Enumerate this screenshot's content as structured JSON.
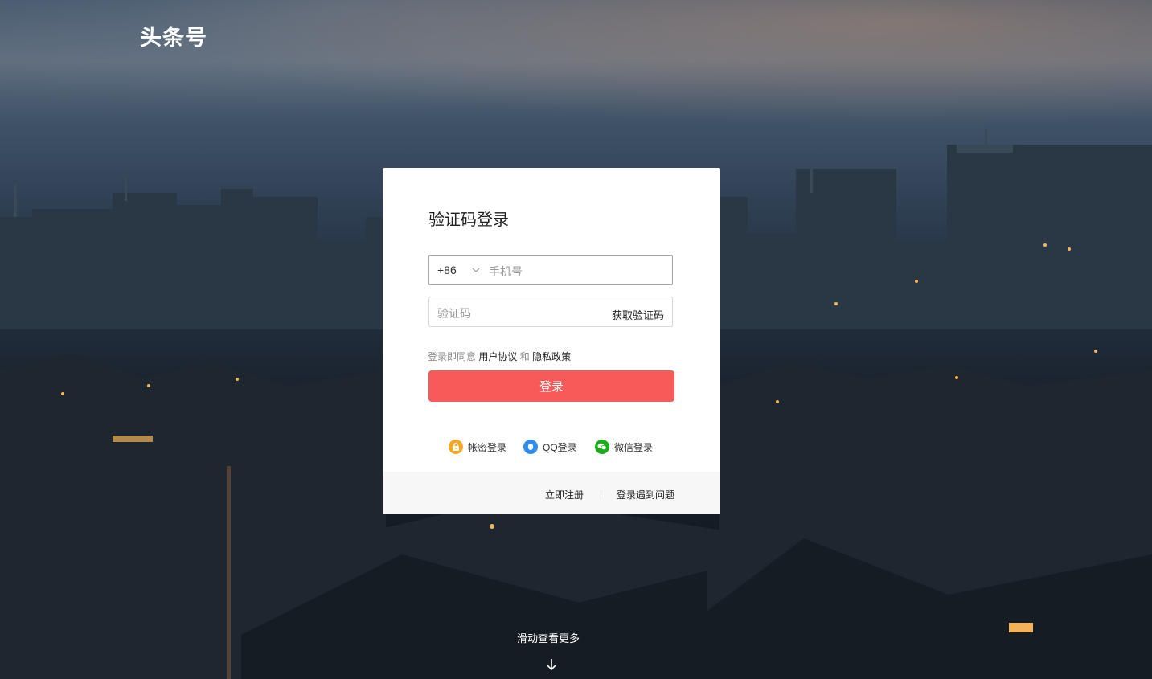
{
  "header": {
    "logo_text": "头条号"
  },
  "login": {
    "title": "验证码登录",
    "country_code": "+86",
    "phone_placeholder": "手机号",
    "code_placeholder": "验证码",
    "get_code_label": "获取验证码",
    "agree_prefix": "登录即同意",
    "user_agreement": "用户协议",
    "agree_and": "和",
    "privacy_policy": "隐私政策",
    "submit_label": "登录",
    "alt_methods": [
      {
        "label": "帐密登录",
        "icon": "lock-icon",
        "color": "#f5a623"
      },
      {
        "label": "QQ登录",
        "icon": "qq-icon",
        "color": "#2d8cf0"
      },
      {
        "label": "微信登录",
        "icon": "wechat-icon",
        "color": "#1aad19"
      }
    ],
    "footer": {
      "register": "立即注册",
      "problem": "登录遇到问题"
    }
  },
  "scroll_hint": "滑动查看更多",
  "colors": {
    "primary": "#f85959"
  }
}
